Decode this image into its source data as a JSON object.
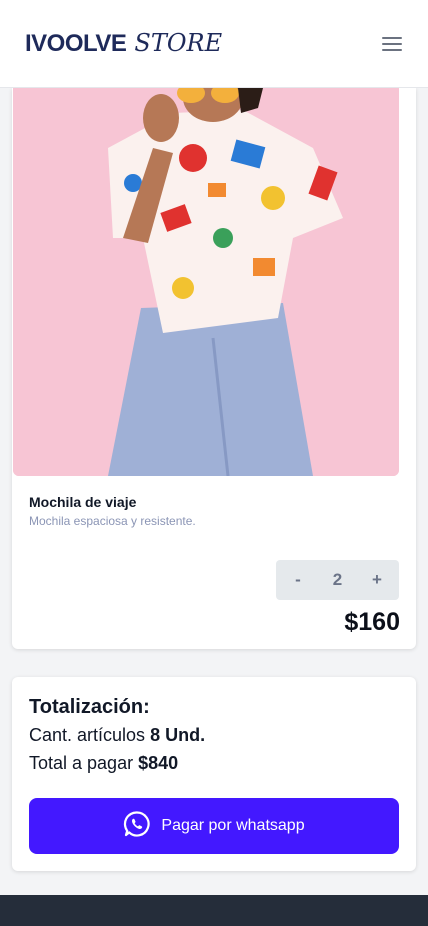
{
  "header": {
    "brand_main": "IVOOLVE",
    "brand_sub": "STORE"
  },
  "product": {
    "name": "Mochila de viaje",
    "description": "Mochila espaciosa y resistente.",
    "quantity": "2",
    "decrement_label": "-",
    "increment_label": "+",
    "price": "$160"
  },
  "totals": {
    "title": "Totalización:",
    "items_label": "Cant. artículos",
    "items_value": "8 Und.",
    "pay_label": "Total a pagar",
    "pay_value": "$840"
  },
  "checkout": {
    "button_label": "Pagar por whatsapp"
  },
  "colors": {
    "brand": "#1e2a5a",
    "pay_button": "#4318ff",
    "footer": "#252d3a",
    "image_background": "#f7c5d4"
  }
}
